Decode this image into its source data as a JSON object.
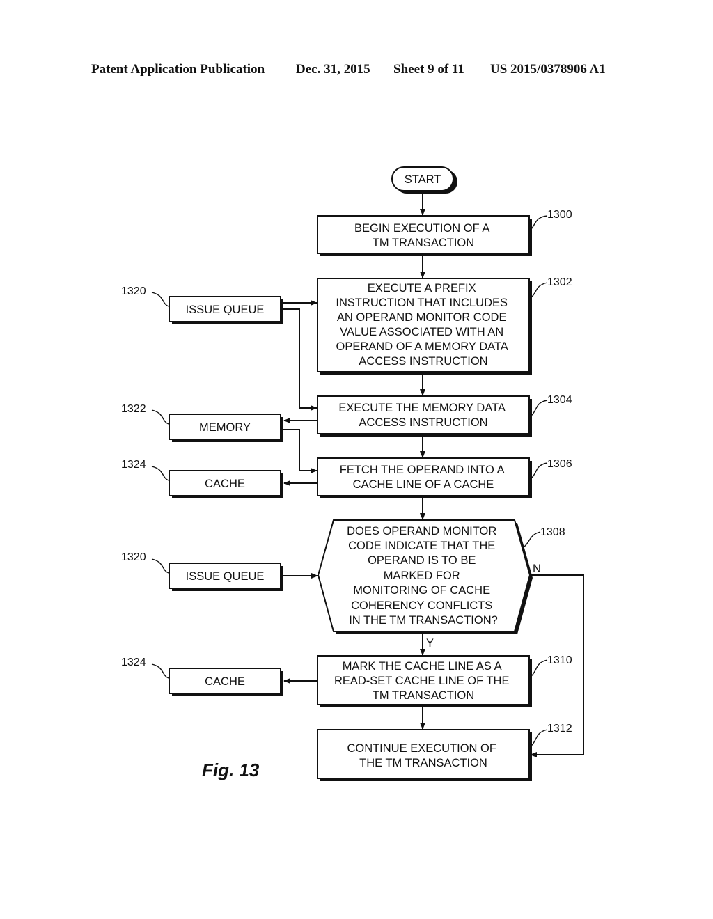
{
  "header": {
    "publication": "Patent Application Publication",
    "date": "Dec. 31, 2015",
    "sheet": "Sheet 9 of 11",
    "number": "US 2015/0378906 A1"
  },
  "figure_label": "Fig. 13",
  "flowchart": {
    "start": "START",
    "steps": [
      {
        "ref": "1300",
        "lines": [
          "BEGIN EXECUTION OF A",
          "TM TRANSACTION"
        ]
      },
      {
        "ref": "1302",
        "lines": [
          "EXECUTE A PREFIX",
          "INSTRUCTION THAT INCLUDES",
          "AN OPERAND MONITOR CODE",
          "VALUE ASSOCIATED WITH AN",
          "OPERAND OF A MEMORY DATA",
          "ACCESS INSTRUCTION"
        ]
      },
      {
        "ref": "1304",
        "lines": [
          "EXECUTE THE MEMORY DATA",
          "ACCESS INSTRUCTION"
        ]
      },
      {
        "ref": "1306",
        "lines": [
          "FETCH THE OPERAND INTO A",
          "CACHE LINE OF A CACHE"
        ]
      },
      {
        "ref": "1308",
        "lines": [
          "DOES OPERAND MONITOR",
          "CODE INDICATE THAT THE",
          "OPERAND IS TO BE",
          "MARKED FOR",
          "MONITORING OF CACHE",
          "COHERENCY CONFLICTS",
          "IN THE TM TRANSACTION?"
        ]
      },
      {
        "ref": "1310",
        "lines": [
          "MARK THE CACHE LINE AS A",
          "READ-SET CACHE LINE OF THE",
          "TM TRANSACTION"
        ]
      },
      {
        "ref": "1312",
        "lines": [
          "CONTINUE EXECUTION OF",
          "THE TM TRANSACTION"
        ]
      }
    ],
    "decision_yes": "Y",
    "decision_no": "N",
    "side_blocks": [
      {
        "ref": "1320",
        "label": "ISSUE QUEUE"
      },
      {
        "ref": "1322",
        "label": "MEMORY"
      },
      {
        "ref": "1324",
        "label": "CACHE"
      },
      {
        "ref": "1320",
        "label": "ISSUE QUEUE"
      },
      {
        "ref": "1324",
        "label": "CACHE"
      }
    ]
  }
}
